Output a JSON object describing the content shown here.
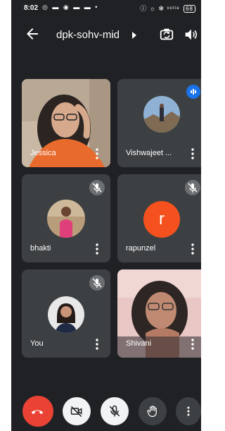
{
  "status_bar": {
    "time": "8:02",
    "left_icons": "◎ ▬ ◉ ▬ ▬ •",
    "right_icons": "ⓘ ☼ ✻ ᵛᵒˡᵗᵉ",
    "battery": "68"
  },
  "header": {
    "meeting_code": "dpk-sohv-mid"
  },
  "participants": [
    {
      "name": "Jessica",
      "type": "video",
      "muted": false
    },
    {
      "name": "Vishwajeet ...",
      "type": "avatar-photo",
      "speaking": true
    },
    {
      "name": "bhakti",
      "type": "avatar-photo",
      "muted": true
    },
    {
      "name": "rapunzel",
      "type": "letter",
      "letter": "r",
      "avatar_color": "#f4511e",
      "muted": true
    },
    {
      "name": "You",
      "type": "avatar-photo",
      "muted": true
    },
    {
      "name": "Shivani",
      "type": "video",
      "muted": false
    }
  ],
  "controls": {
    "end_call": "end-call",
    "camera": "camera-off",
    "mic": "mic-off",
    "hand": "raise-hand",
    "more": "more-options"
  },
  "colors": {
    "background": "#202124",
    "tile": "#3c4043",
    "end_call": "#ea4335",
    "accent": "#1a73e8"
  }
}
